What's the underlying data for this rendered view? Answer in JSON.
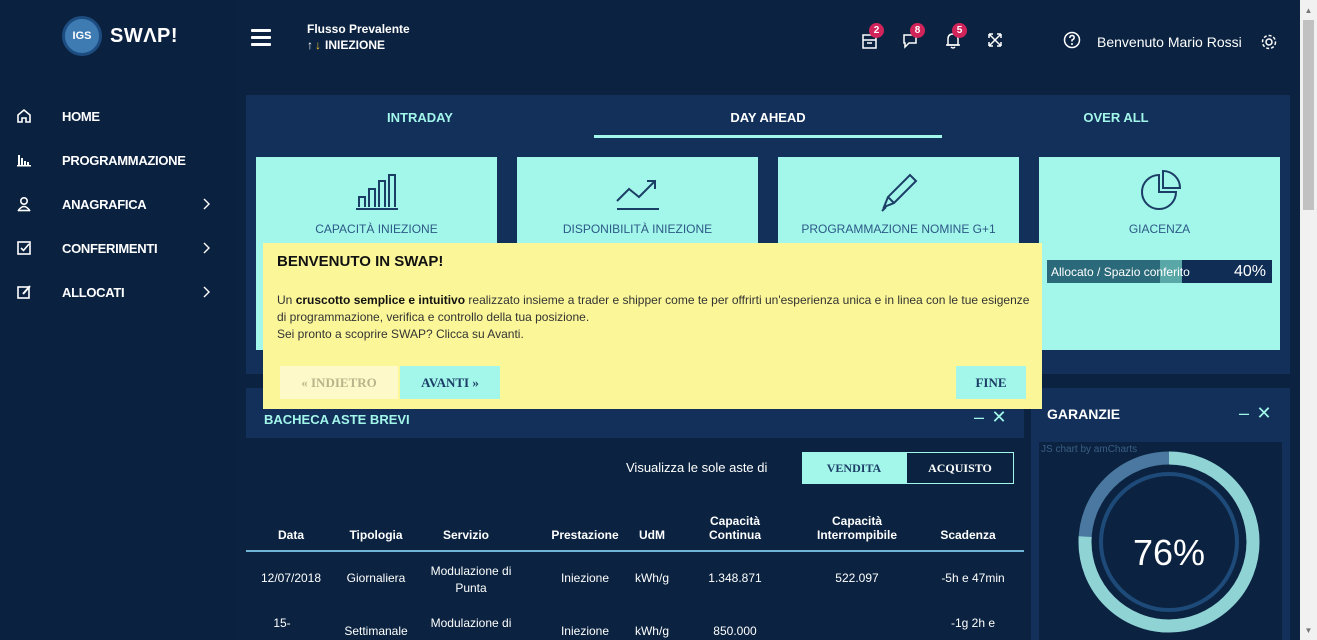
{
  "app": {
    "logo_badge": "IGS",
    "logo_text": "SWΛP!"
  },
  "sidebar": {
    "items": [
      {
        "label": "HOME",
        "icon": "home-icon",
        "has_submenu": false
      },
      {
        "label": "PROGRAMMAZIONE",
        "icon": "bar-chart-icon",
        "has_submenu": false
      },
      {
        "label": "ANAGRAFICA",
        "icon": "user-icon",
        "has_submenu": true
      },
      {
        "label": "CONFERIMENTI",
        "icon": "checkbox-icon",
        "has_submenu": true
      },
      {
        "label": "ALLOCATI",
        "icon": "edit-icon",
        "has_submenu": true
      }
    ]
  },
  "header": {
    "flow_title": "Flusso Prevalente",
    "flow_value": "INIEZIONE",
    "badges": {
      "inbox": "2",
      "messages": "8",
      "notifications": "5"
    },
    "welcome": "Benvenuto Mario Rossi"
  },
  "tabs": [
    {
      "label": "INTRADAY",
      "active": false
    },
    {
      "label": "DAY AHEAD",
      "active": true
    },
    {
      "label": "OVER ALL",
      "active": false
    }
  ],
  "cards": [
    {
      "title": "CAPACITÀ INIEZIONE",
      "icon": "bar-chart-icon"
    },
    {
      "title": "DISPONIBILITÀ INIEZIONE",
      "icon": "trend-up-icon"
    },
    {
      "title": "PROGRAMMAZIONE NOMINE G+1",
      "icon": "pen-icon"
    },
    {
      "title": "GIACENZA",
      "icon": "pie-chart-icon"
    }
  ],
  "giacenza": {
    "label": "Allocato / Spazio conferito",
    "percent_text": "40%",
    "percent": 40
  },
  "bacheca": {
    "title": "BACHECA ASTE BREVI",
    "filter_label": "Visualizza le sole aste di",
    "vendita_label": "VENDITA",
    "acquisto_label": "ACQUISTO",
    "columns": [
      "Data",
      "Tipologia",
      "Servizio",
      "Prestazione",
      "UdM",
      "Capacità Continua",
      "Capacità Interrompibile",
      "Scadenza"
    ],
    "rows": [
      [
        "12/07/2018",
        "Giornaliera",
        "Modulazione di Punta",
        "Iniezione",
        "kWh/g",
        "1.348.871",
        "522.097",
        "-5h e 47min"
      ],
      [
        "15-",
        "Settimanale",
        "Modulazione di",
        "Iniezione",
        "kWh/g",
        "850.000",
        "",
        "-1g 2h e"
      ]
    ]
  },
  "garanzie": {
    "title": "GARANZIE",
    "credit": "JS chart by amCharts",
    "percent_text": "76%",
    "percent": 76
  },
  "popup": {
    "title": "BENVENUTO IN SWAP!",
    "text_prefix": "Un ",
    "text_bold": "cruscotto semplice e intuitivo",
    "text_rest": " realizzato insieme a trader e shipper come te per offrirti un'esperienza unica e in linea con le tue esigenze di programmazione, verifica e controllo della tua posizione.",
    "text_line2": "Sei pronto a scoprire SWAP? Clicca su Avanti.",
    "back_label": "« INDIETRO",
    "next_label": "AVANTI »",
    "end_label": "FINE"
  },
  "colors": {
    "background": "#0b2340",
    "panel": "#12305a",
    "accent": "#a3f6ea",
    "badge": "#d1245a",
    "popup": "#fbf799"
  }
}
